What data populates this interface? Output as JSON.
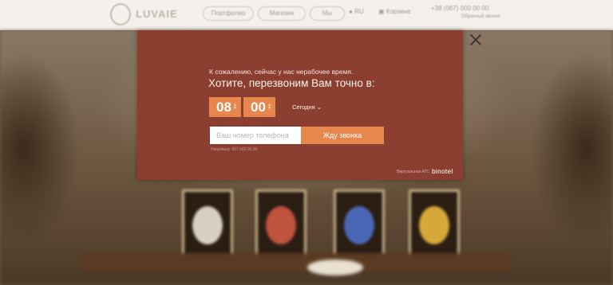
{
  "background": {
    "logo_text": "LUVAIE",
    "nav": [
      "Портфолио",
      "Магазин",
      "Мы"
    ],
    "lang": "RU",
    "cart": "Корзина",
    "phone": "+38 (067) 000 00 00",
    "phone_sub": "Обратный звонок"
  },
  "callback_popup": {
    "message_small": "К сожалению, сейчас у нас нерабочее время.",
    "message_big": "Хотите, перезвоним Вам точно в:",
    "hours": "08",
    "minutes": "00",
    "day": "Сегодня",
    "phone_placeholder": "Ваш номер телефона",
    "submit_label": "Жду звонка",
    "hint": "Например: 067 000 00 00",
    "powered_by": "Виртуальная АТС",
    "brand": "binotel",
    "accent_color": "#e8874d",
    "panel_color": "#8d3f31"
  }
}
